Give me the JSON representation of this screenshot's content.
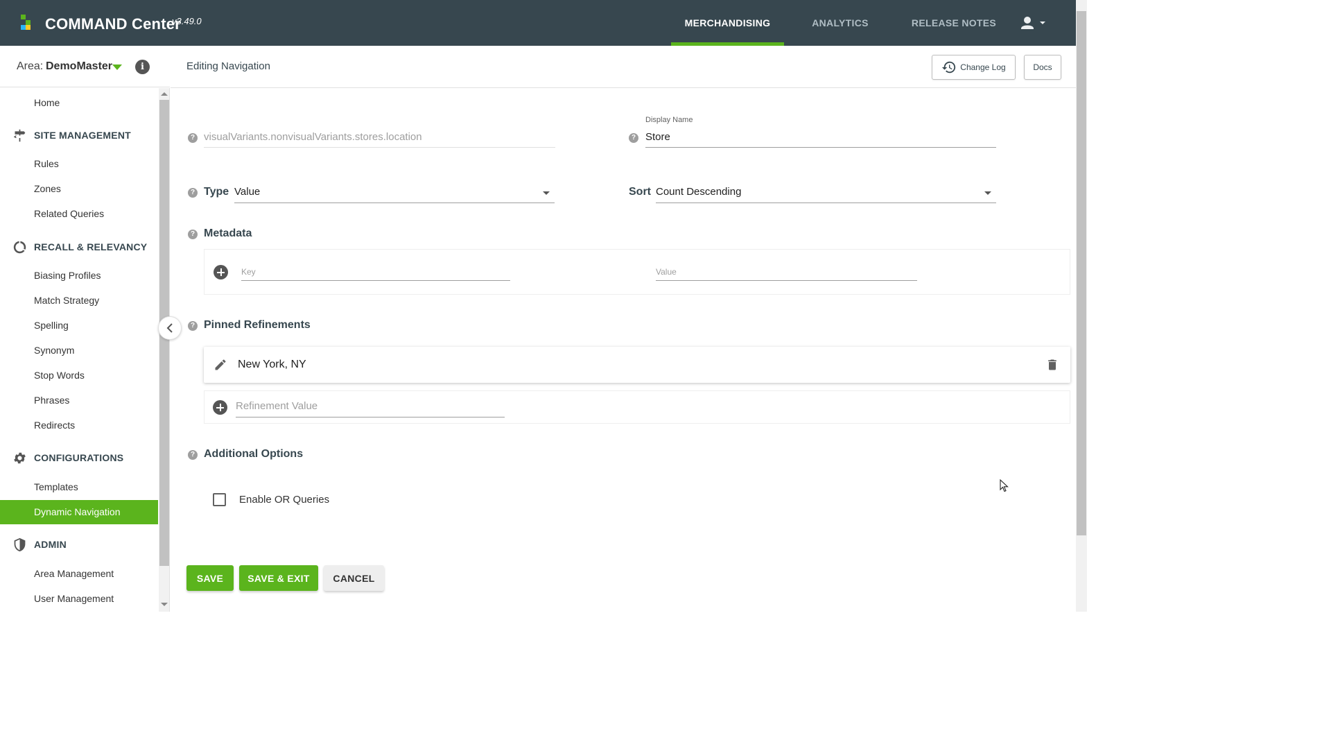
{
  "app": {
    "brand": "COMMAND Center",
    "version": "v3.49.0",
    "nav": [
      "MERCHANDISING",
      "ANALYTICS",
      "RELEASE NOTES"
    ],
    "active_nav": "MERCHANDISING"
  },
  "colors": {
    "topbar": "#37474f",
    "accent": "#5bb41d"
  },
  "area": {
    "label": "Area:",
    "value": "DemoMaster"
  },
  "sidebar": {
    "home": "Home",
    "sections": [
      {
        "title": "SITE MANAGEMENT",
        "icon": "signpost-icon",
        "items": [
          "Rules",
          "Zones",
          "Related Queries"
        ]
      },
      {
        "title": "RECALL & RELEVANCY",
        "icon": "donut-icon",
        "items": [
          "Biasing Profiles",
          "Match Strategy",
          "Spelling",
          "Synonym",
          "Stop Words",
          "Phrases",
          "Redirects"
        ]
      },
      {
        "title": "CONFIGURATIONS",
        "icon": "gear-icon",
        "items": [
          "Templates",
          "Dynamic Navigation"
        ]
      },
      {
        "title": "ADMIN",
        "icon": "shield-icon",
        "items": [
          "Area Management",
          "User Management"
        ]
      }
    ],
    "active_item": "Dynamic Navigation"
  },
  "header": {
    "title": "Editing Navigation",
    "change_log": "Change Log",
    "docs": "Docs"
  },
  "form": {
    "field_name": "visualVariants.nonvisualVariants.stores.location",
    "display_name_label": "Display Name",
    "display_name": "Store",
    "type_label": "Type",
    "type_value": "Value",
    "sort_label": "Sort",
    "sort_value": "Count Descending",
    "metadata_title": "Metadata",
    "metadata_key_placeholder": "Key",
    "metadata_value_placeholder": "Value",
    "pinned_title": "Pinned Refinements",
    "pinned_items": [
      "New York, NY"
    ],
    "refinement_placeholder": "Refinement Value",
    "additional_title": "Additional Options",
    "enable_or_label": "Enable OR Queries",
    "enable_or_checked": false
  },
  "actions": {
    "save": "SAVE",
    "save_exit": "SAVE & EXIT",
    "cancel": "CANCEL"
  }
}
